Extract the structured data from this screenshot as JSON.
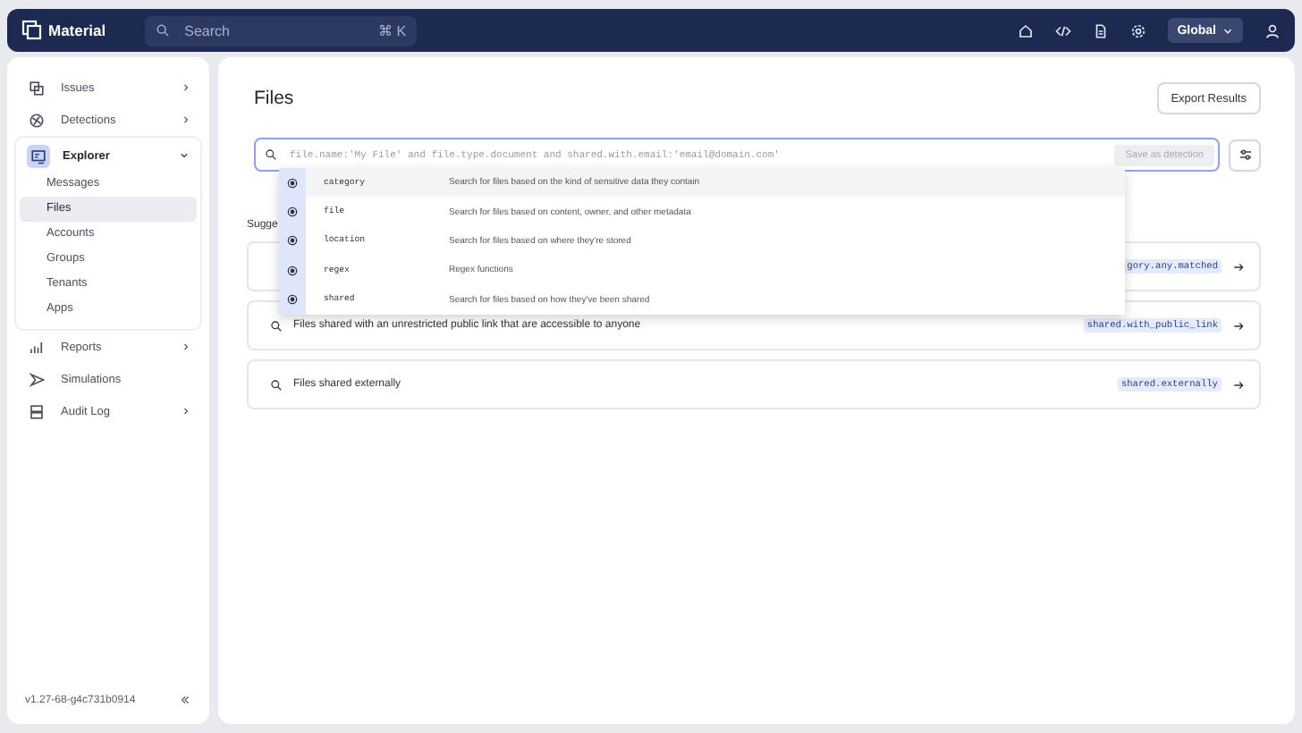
{
  "topbar": {
    "logo": "Material",
    "search": {
      "placeholder": "Search",
      "shortcut": "⌘ K"
    },
    "scope": "Global"
  },
  "sidebar": {
    "items": [
      {
        "label": "Issues",
        "expandable": true,
        "expanded": false
      },
      {
        "label": "Detections",
        "expandable": true,
        "expanded": false
      },
      {
        "label": "Explorer",
        "expandable": true,
        "expanded": true,
        "children": [
          {
            "label": "Messages",
            "selected": false
          },
          {
            "label": "Files",
            "selected": true
          },
          {
            "label": "Accounts",
            "selected": false
          },
          {
            "label": "Groups",
            "selected": false
          },
          {
            "label": "Tenants",
            "selected": false
          },
          {
            "label": "Apps",
            "selected": false
          }
        ]
      },
      {
        "label": "Reports",
        "expandable": true,
        "expanded": false
      },
      {
        "label": "Simulations",
        "expandable": false,
        "expanded": false
      },
      {
        "label": "Audit Log",
        "expandable": true,
        "expanded": false
      }
    ],
    "version": "v1.27-68-g4c731b0914"
  },
  "page": {
    "title": "Files",
    "export_button": "Export Results",
    "query": {
      "placeholder": "file.name:'My File' and file.type.document and shared.with.email:'email@domain.com'",
      "save_button": "Save as detection",
      "save_disabled": true
    },
    "autocomplete": [
      {
        "keyword": "category",
        "description": "Search for files based on the kind of sensitive data they contain",
        "selected": true
      },
      {
        "keyword": "file",
        "description": "Search for files based on content, owner, and other metadata",
        "selected": false
      },
      {
        "keyword": "location",
        "description": "Search for files based on where they're stored",
        "selected": false
      },
      {
        "keyword": "regex",
        "description": "Regex functions",
        "selected": false
      },
      {
        "keyword": "shared",
        "description": "Search for files based on how they've been shared",
        "selected": false
      }
    ],
    "suggestions_label": "Sugge",
    "suggestions": [
      {
        "query": "gory.any.matched"
      },
      {
        "text": "Files shared with an unrestricted public link that are accessible to anyone",
        "query": "shared.with_public_link"
      },
      {
        "text": "Files shared externally",
        "query": "shared.externally"
      }
    ]
  }
}
